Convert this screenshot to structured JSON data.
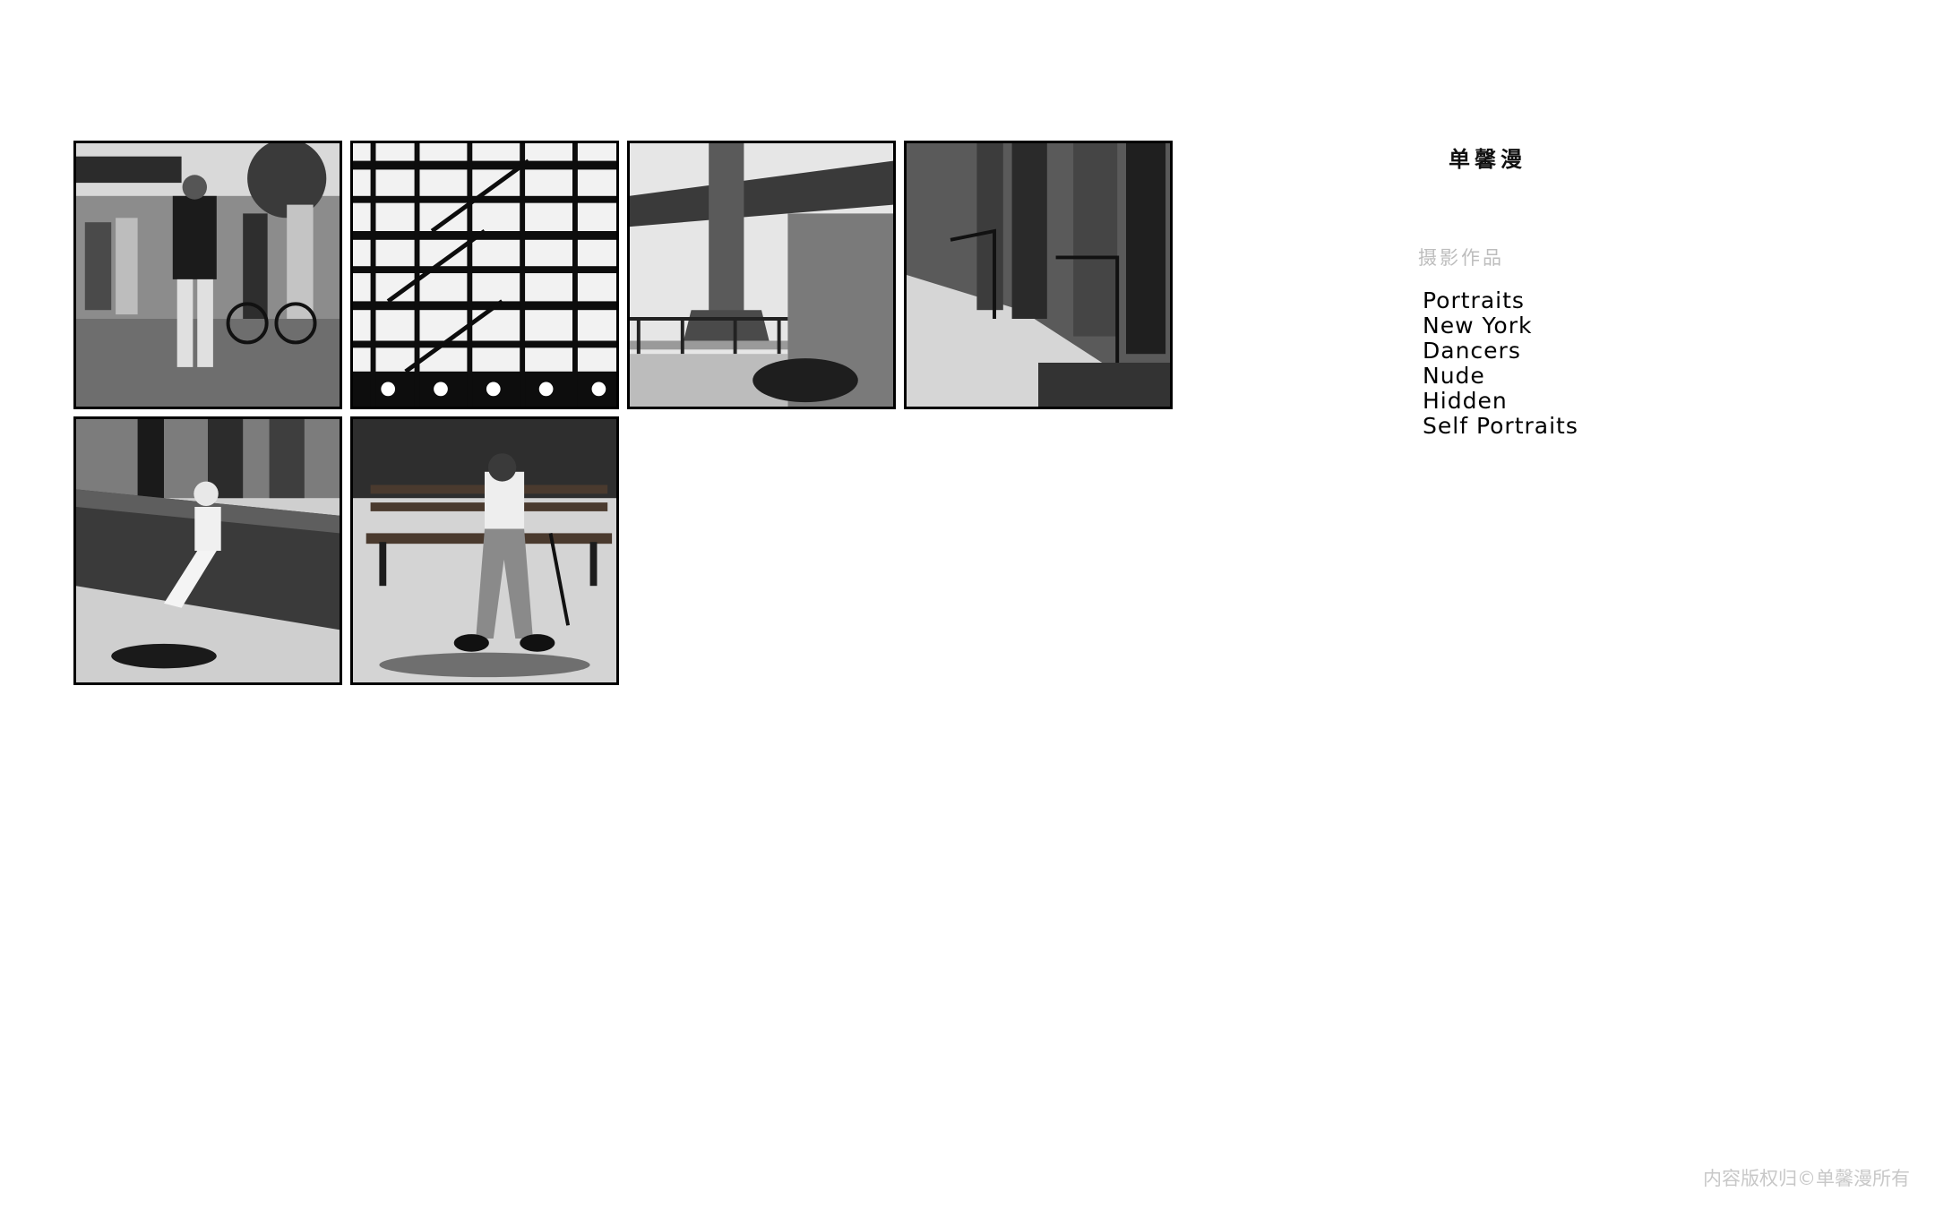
{
  "site": {
    "title": "单馨漫",
    "section_label": "摄影作品"
  },
  "nav": {
    "items": [
      {
        "label": "Portraits"
      },
      {
        "label": "New York"
      },
      {
        "label": "Dancers"
      },
      {
        "label": "Nude"
      },
      {
        "label": "Hidden"
      },
      {
        "label": "Self Portraits"
      }
    ]
  },
  "gallery": {
    "photos": [
      {
        "subject": "street-crowd-portrait"
      },
      {
        "subject": "fire-escape-facade"
      },
      {
        "subject": "bridge-underside"
      },
      {
        "subject": "columned-doorway-steps"
      },
      {
        "subject": "child-on-fountain-ledge"
      },
      {
        "subject": "man-sleeping-on-bench"
      }
    ]
  },
  "footer": {
    "copyright": "内容版权归©单馨漫所有"
  }
}
